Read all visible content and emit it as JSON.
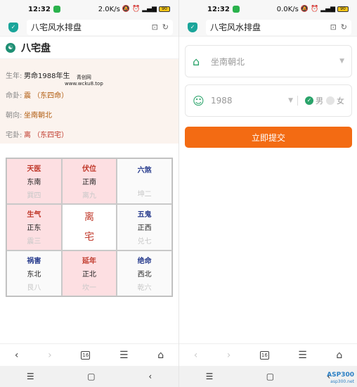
{
  "status_left": {
    "time": "12:32",
    "speed": "2.0K/s",
    "battery": "90"
  },
  "status_right": {
    "time": "12:32",
    "speed": "0.0K/s",
    "battery": "90"
  },
  "address": {
    "title": "八宅风水排盘"
  },
  "bazhai": {
    "title": "八宅盘",
    "info": [
      {
        "label": "生年:",
        "value": "男命1988年生"
      },
      {
        "label": "命卦:",
        "value": "震 （东四命）"
      },
      {
        "label": "朝向:",
        "value": "坐南朝北"
      },
      {
        "label": "宅卦:",
        "value": "离 （东四宅）"
      }
    ],
    "watermark": {
      "line1": "青创网",
      "line2": "www.wcku8.top"
    },
    "grid": [
      {
        "star": "天医",
        "dir": "东南",
        "gua": "巽四"
      },
      {
        "star": "伏位",
        "dir": "正南",
        "gua": "离九"
      },
      {
        "star": "六煞",
        "dir": "",
        "gua": "坤二"
      },
      {
        "star": "生气",
        "dir": "正东",
        "gua": "震三"
      },
      {
        "center1": "离",
        "center2": "宅"
      },
      {
        "star": "五鬼",
        "dir": "正西",
        "gua": "兑七"
      },
      {
        "star": "祸害",
        "dir": "东北",
        "gua": "艮八"
      },
      {
        "star": "延年",
        "dir": "正北",
        "gua": "坎一"
      },
      {
        "star": "绝命",
        "dir": "西北",
        "gua": "乾六"
      }
    ]
  },
  "form": {
    "orientation_placeholder": "坐南朝北",
    "year_value": "1988",
    "gender_male": "男",
    "gender_female": "女",
    "submit_label": "立即提交"
  },
  "nav": {
    "tabs_count": "16"
  },
  "brand": {
    "name": "ASP300",
    "url": "asp300.net"
  },
  "colors": {
    "accent": "#f36b13",
    "green": "#2aa36a",
    "lucky_bg": "#fddfe2",
    "red": "#c0392b",
    "blue": "#2b3f8f"
  }
}
